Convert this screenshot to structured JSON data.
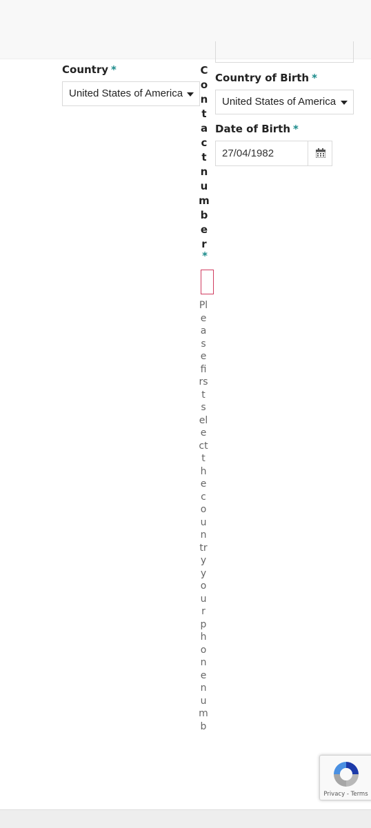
{
  "form": {
    "country": {
      "label": "Country",
      "required_marker": "*",
      "value": "United States of America"
    },
    "contact_number": {
      "label": "Contact number",
      "required_marker": "*",
      "value": "",
      "help_text": "Please first select the country your phone numb"
    },
    "country_of_birth": {
      "label": "Country of Birth",
      "required_marker": "*",
      "value": "United States of America"
    },
    "date_of_birth": {
      "label": "Date of Birth",
      "required_marker": "*",
      "value": "27/04/1982"
    }
  },
  "recaptcha": {
    "privacy_label": "Privacy",
    "separator": " - ",
    "terms_label": "Terms"
  },
  "colors": {
    "required_marker": "#1a8a8a",
    "invalid_border": "#d03a5e"
  }
}
